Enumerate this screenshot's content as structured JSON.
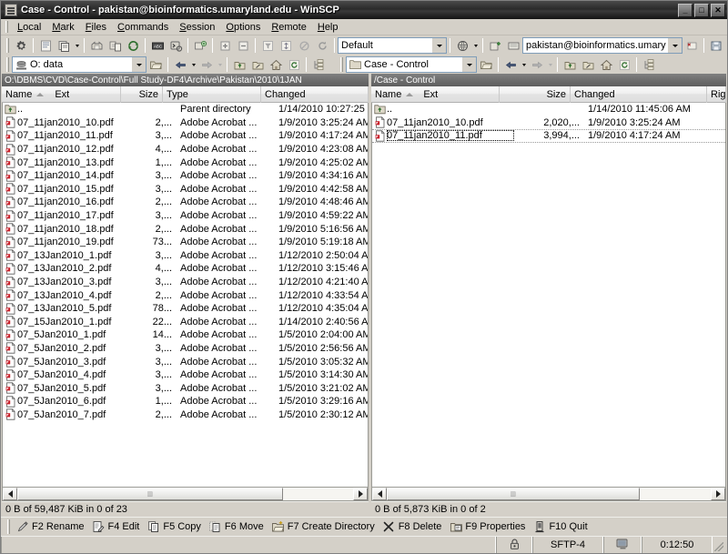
{
  "window": {
    "title": "Case - Control - pakistan@bioinformatics.umaryland.edu - WinSCP",
    "minimize_label": "_",
    "maximize_label": "□",
    "close_label": "✕"
  },
  "menubar": {
    "items": [
      {
        "label": "Local",
        "accel": "L"
      },
      {
        "label": "Mark",
        "accel": "M"
      },
      {
        "label": "Files",
        "accel": "F"
      },
      {
        "label": "Commands",
        "accel": "C"
      },
      {
        "label": "Session",
        "accel": "S"
      },
      {
        "label": "Options",
        "accel": "O"
      },
      {
        "label": "Remote",
        "accel": "R"
      },
      {
        "label": "Help",
        "accel": "H"
      }
    ]
  },
  "toolbar": {
    "session_preset": "Default",
    "session_name": "pakistan@bioinformatics.umary"
  },
  "local_nav": {
    "drive": "O: data"
  },
  "remote_nav": {
    "directory": "Case - Control"
  },
  "left_panel": {
    "path": "O:\\DBMS\\CVD\\Case-Control\\Full Study-DF4\\Archive\\Pakistan\\2010\\1JAN",
    "columns": [
      "Name",
      "Ext",
      "Size",
      "Type",
      "Changed"
    ],
    "sort_column": "Name",
    "sort_direction": "asc",
    "rows": [
      {
        "icon": "parent-folder-icon",
        "name": "..",
        "size": "",
        "type": "Parent directory",
        "changed": "1/14/2010  10:27:25"
      },
      {
        "icon": "pdf-icon",
        "name": "07_11jan2010_10.pdf",
        "size": "2,...",
        "type": "Adobe Acrobat ...",
        "changed": "1/9/2010  3:25:24 AM"
      },
      {
        "icon": "pdf-icon",
        "name": "07_11jan2010_11.pdf",
        "size": "3,...",
        "type": "Adobe Acrobat ...",
        "changed": "1/9/2010  4:17:24 AM"
      },
      {
        "icon": "pdf-icon",
        "name": "07_11jan2010_12.pdf",
        "size": "4,...",
        "type": "Adobe Acrobat ...",
        "changed": "1/9/2010  4:23:08 AM"
      },
      {
        "icon": "pdf-icon",
        "name": "07_11jan2010_13.pdf",
        "size": "1,...",
        "type": "Adobe Acrobat ...",
        "changed": "1/9/2010  4:25:02 AM"
      },
      {
        "icon": "pdf-icon",
        "name": "07_11jan2010_14.pdf",
        "size": "3,...",
        "type": "Adobe Acrobat ...",
        "changed": "1/9/2010  4:34:16 AM"
      },
      {
        "icon": "pdf-icon",
        "name": "07_11jan2010_15.pdf",
        "size": "3,...",
        "type": "Adobe Acrobat ...",
        "changed": "1/9/2010  4:42:58 AM"
      },
      {
        "icon": "pdf-icon",
        "name": "07_11jan2010_16.pdf",
        "size": "2,...",
        "type": "Adobe Acrobat ...",
        "changed": "1/9/2010  4:48:46 AM"
      },
      {
        "icon": "pdf-icon",
        "name": "07_11jan2010_17.pdf",
        "size": "3,...",
        "type": "Adobe Acrobat ...",
        "changed": "1/9/2010  4:59:22 AM"
      },
      {
        "icon": "pdf-icon",
        "name": "07_11jan2010_18.pdf",
        "size": "2,...",
        "type": "Adobe Acrobat ...",
        "changed": "1/9/2010  5:16:56 AM"
      },
      {
        "icon": "pdf-icon",
        "name": "07_11jan2010_19.pdf",
        "size": "73...",
        "type": "Adobe Acrobat ...",
        "changed": "1/9/2010  5:19:18 AM"
      },
      {
        "icon": "pdf-icon",
        "name": "07_13Jan2010_1.pdf",
        "size": "3,...",
        "type": "Adobe Acrobat ...",
        "changed": "1/12/2010  2:50:04 A"
      },
      {
        "icon": "pdf-icon",
        "name": "07_13Jan2010_2.pdf",
        "size": "4,...",
        "type": "Adobe Acrobat ...",
        "changed": "1/12/2010  3:15:46 A"
      },
      {
        "icon": "pdf-icon",
        "name": "07_13Jan2010_3.pdf",
        "size": "3,...",
        "type": "Adobe Acrobat ...",
        "changed": "1/12/2010  4:21:40 A"
      },
      {
        "icon": "pdf-icon",
        "name": "07_13Jan2010_4.pdf",
        "size": "2,...",
        "type": "Adobe Acrobat ...",
        "changed": "1/12/2010  4:33:54 A"
      },
      {
        "icon": "pdf-icon",
        "name": "07_13Jan2010_5.pdf",
        "size": "78...",
        "type": "Adobe Acrobat ...",
        "changed": "1/12/2010  4:35:04 A"
      },
      {
        "icon": "pdf-icon",
        "name": "07_15Jan2010_1.pdf",
        "size": "22...",
        "type": "Adobe Acrobat ...",
        "changed": "1/14/2010  2:40:56 A"
      },
      {
        "icon": "pdf-icon",
        "name": "07_5Jan2010_1.pdf",
        "size": "14...",
        "type": "Adobe Acrobat ...",
        "changed": "1/5/2010  2:04:00 AM"
      },
      {
        "icon": "pdf-icon",
        "name": "07_5Jan2010_2.pdf",
        "size": "3,...",
        "type": "Adobe Acrobat ...",
        "changed": "1/5/2010  2:56:56 AM"
      },
      {
        "icon": "pdf-icon",
        "name": "07_5Jan2010_3.pdf",
        "size": "3,...",
        "type": "Adobe Acrobat ...",
        "changed": "1/5/2010  3:05:32 AM"
      },
      {
        "icon": "pdf-icon",
        "name": "07_5Jan2010_4.pdf",
        "size": "3,...",
        "type": "Adobe Acrobat ...",
        "changed": "1/5/2010  3:14:30 AM"
      },
      {
        "icon": "pdf-icon",
        "name": "07_5Jan2010_5.pdf",
        "size": "3,...",
        "type": "Adobe Acrobat ...",
        "changed": "1/5/2010  3:21:02 AM"
      },
      {
        "icon": "pdf-icon",
        "name": "07_5Jan2010_6.pdf",
        "size": "1,...",
        "type": "Adobe Acrobat ...",
        "changed": "1/5/2010  3:29:16 AM"
      },
      {
        "icon": "pdf-icon",
        "name": "07_5Jan2010_7.pdf",
        "size": "2,...",
        "type": "Adobe Acrobat ...",
        "changed": "1/5/2010  2:30:12 AM"
      }
    ],
    "status": "0 B of 59,487 KiB in 0 of 23"
  },
  "right_panel": {
    "path": "/Case - Control",
    "columns": [
      "Name",
      "Ext",
      "Size",
      "Changed",
      "Righ"
    ],
    "sort_column": "Name",
    "sort_direction": "asc",
    "rows": [
      {
        "icon": "parent-folder-icon",
        "name": "..",
        "size": "",
        "changed": "1/14/2010 11:45:06 AM",
        "focused": false
      },
      {
        "icon": "pdf-icon",
        "name": "07_11jan2010_10.pdf",
        "size": "2,020,...",
        "changed": "1/9/2010 3:25:24 AM",
        "focused": false
      },
      {
        "icon": "pdf-icon",
        "name": "07_11jan2010_11.pdf",
        "size": "3,994,...",
        "changed": "1/9/2010 4:17:24 AM",
        "focused": true
      }
    ],
    "status": "0 B of 5,873 KiB in 0 of 2"
  },
  "function_keys": [
    {
      "icon": "rename-pencil-icon",
      "label": "F2 Rename"
    },
    {
      "icon": "edit-document-icon",
      "label": "F4 Edit"
    },
    {
      "icon": "copy-files-icon",
      "label": "F5 Copy"
    },
    {
      "icon": "move-files-icon",
      "label": "F6 Move"
    },
    {
      "icon": "new-folder-icon",
      "label": "F7 Create Directory"
    },
    {
      "icon": "delete-x-icon",
      "label": "F8 Delete"
    },
    {
      "icon": "properties-icon",
      "label": "F9 Properties"
    },
    {
      "icon": "quit-door-icon",
      "label": "F10 Quit"
    }
  ],
  "statusbar": {
    "security_icon": "padlock-icon",
    "protocol": "SFTP-4",
    "transfer_icon": "monitor-icon",
    "duration": "0:12:50"
  },
  "colors": {
    "title_bar": "#2a2a2a",
    "face": "#d4d0c8",
    "path_bar": "#6e6e6e",
    "list_bg": "#ffffff",
    "pdf_red": "#c8202a"
  }
}
